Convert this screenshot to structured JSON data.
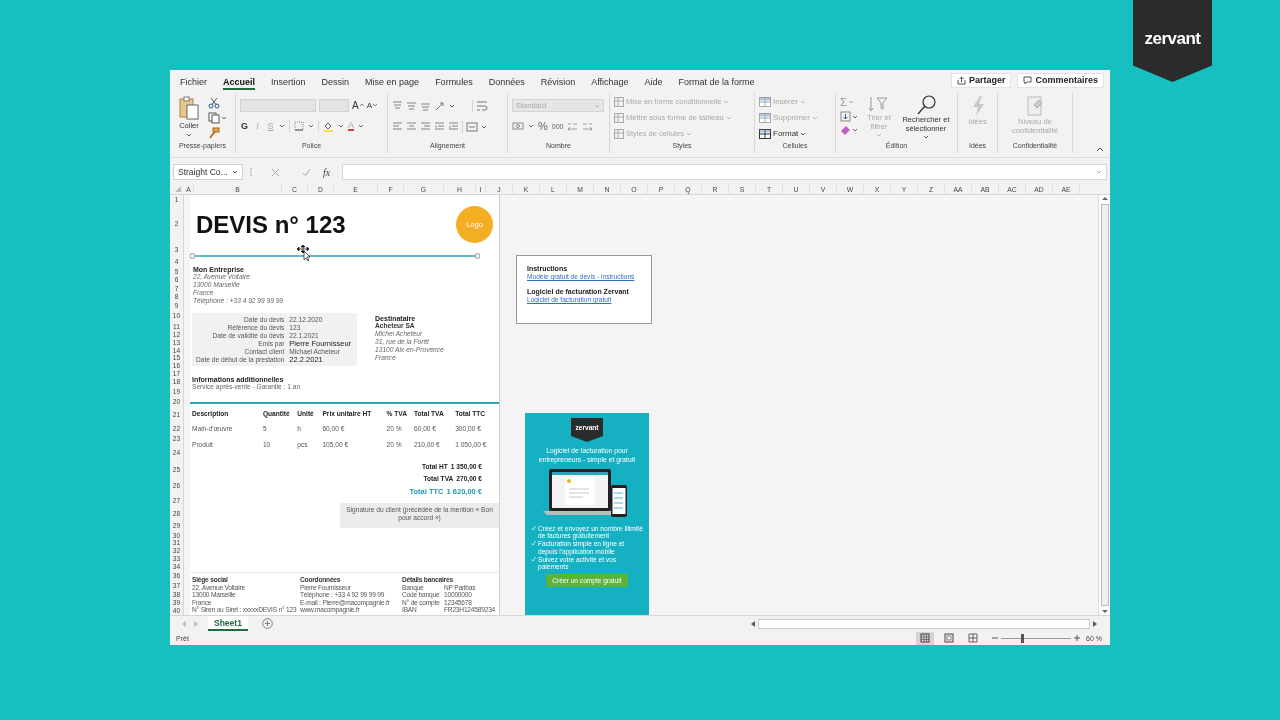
{
  "badge": {
    "text": "zervant"
  },
  "menu": {
    "tabs": [
      {
        "label": "Fichier",
        "selected": false
      },
      {
        "label": "Accueil",
        "selected": true
      },
      {
        "label": "Insertion",
        "selected": false
      },
      {
        "label": "Dessin",
        "selected": false
      },
      {
        "label": "Mise en page",
        "selected": false
      },
      {
        "label": "Formules",
        "selected": false
      },
      {
        "label": "Données",
        "selected": false
      },
      {
        "label": "Révision",
        "selected": false
      },
      {
        "label": "Affichage",
        "selected": false
      },
      {
        "label": "Aide",
        "selected": false
      },
      {
        "label": "Format de la forme",
        "selected": false
      }
    ],
    "actions": [
      {
        "kind": "share",
        "label": "Partager"
      },
      {
        "kind": "comments",
        "label": "Commentaires"
      }
    ]
  },
  "ribbon": {
    "groups": [
      {
        "kind": "clipboard",
        "label": "Presse-papiers",
        "paste": {
          "label": "Coller",
          "disabled": false
        }
      },
      {
        "kind": "font",
        "label": "Police",
        "fields": [
          {
            "kind": "font_name",
            "disabled": true
          },
          {
            "kind": "font_size",
            "disabled": true
          }
        ],
        "size_buttons": [
          {
            "kind": "grow",
            "label": "A"
          },
          {
            "kind": "shrink",
            "label": "A"
          }
        ],
        "styles": [
          {
            "label": "G",
            "disabled": false
          },
          {
            "label": "I",
            "disabled": true
          },
          {
            "label": "S",
            "disabled": true
          }
        ],
        "font_color": "A"
      },
      {
        "kind": "alignment",
        "label": "Alignement"
      },
      {
        "kind": "number",
        "label": "Nombre",
        "format": {
          "value": "Standard",
          "disabled": true
        },
        "symbols": [
          "%",
          "000"
        ]
      },
      {
        "kind": "styles",
        "label": "Styles",
        "items": [
          {
            "label": "Mise en forme conditionnelle",
            "disabled": true
          },
          {
            "label": "Mettre sous forme de tableau",
            "disabled": true
          },
          {
            "label": "Styles de cellules",
            "disabled": true
          }
        ]
      },
      {
        "kind": "cells",
        "label": "Cellules",
        "items": [
          {
            "label": "Insérer",
            "disabled": true
          },
          {
            "label": "Supprimer",
            "disabled": true
          },
          {
            "label": "Format",
            "disabled": false
          }
        ]
      },
      {
        "kind": "editing",
        "label": "Édition",
        "autosum": "Σ",
        "items": [
          {
            "label": "Trier et filtrer",
            "disabled": true
          },
          {
            "label": "Rechercher et sélectionner",
            "disabled": false
          }
        ]
      },
      {
        "kind": "ideas",
        "label": "Idées",
        "button": {
          "label": "Idées",
          "disabled": true
        }
      },
      {
        "kind": "sensitivity",
        "label": "Confidentialité",
        "button": {
          "label": "Niveau de confidentialité",
          "disabled": true
        }
      }
    ]
  },
  "formula_bar": {
    "name_box": "Straight Co...",
    "fx": "fx"
  },
  "sheet": {
    "columns": [
      "A",
      "B",
      "C",
      "D",
      "E",
      "F",
      "G",
      "H",
      "I",
      "J",
      "K",
      "L",
      "M",
      "N",
      "O",
      "P",
      "Q",
      "R",
      "S",
      "T",
      "U",
      "V",
      "W",
      "X",
      "Y",
      "Z",
      "AA",
      "AB",
      "AC",
      "AD",
      "AE"
    ],
    "rows": [
      "1",
      "2",
      "3",
      "4",
      "5",
      "6",
      "7",
      "8",
      "9",
      "10",
      "11",
      "12",
      "13",
      "14",
      "15",
      "16",
      "17",
      "18",
      "19",
      "20",
      "21",
      "22",
      "23",
      "24",
      "25",
      "26",
      "27",
      "28",
      "29",
      "30",
      "31",
      "32",
      "33",
      "34",
      "36",
      "37",
      "38",
      "39",
      "40"
    ]
  },
  "quote": {
    "title": "DEVIS n° 123",
    "logo": "Logo",
    "company": {
      "name": "Mon Entreprise",
      "lines": [
        "22, Avenue Voltaire",
        "13000 Marseille",
        "France",
        "Téléphone : +33 4 92 99 99 99"
      ]
    },
    "details": [
      {
        "label": "Date du devis",
        "value": "22.12.2020",
        "emphasis": false
      },
      {
        "label": "Référence du devis",
        "value": "123",
        "emphasis": false
      },
      {
        "label": "Date de validité du devis",
        "value": "22.1.2021",
        "emphasis": false
      },
      {
        "label": "Emis par",
        "value": "Pierre Fournisseur",
        "emphasis": true
      },
      {
        "label": "Contact client",
        "value": "Michael Acheteur",
        "emphasis": false
      },
      {
        "label": "Date de début de la prestation",
        "value": "22.2.2021",
        "emphasis": true
      }
    ],
    "recipient": {
      "heading": "Destinataire",
      "name": "Acheteur SA",
      "lines": [
        "Michel Acheteur",
        "31, rue de la Forêt",
        "13100 Aix-en-Provence",
        "France"
      ]
    },
    "additional": {
      "heading": "Informations additionnelles",
      "text": "Service après-vente - Garantie : 1 an"
    },
    "items": {
      "columns": [
        "Description",
        "Quantité",
        "Unité",
        "Prix unitaire HT",
        "% TVA",
        "Total TVA",
        "Total TTC"
      ],
      "rows": [
        [
          "Main-d'œuvre",
          "5",
          "h",
          "60,00 €",
          "20 %",
          "60,00 €",
          "300,00 €"
        ],
        [
          "Produit",
          "10",
          "pcs",
          "105,00 €",
          "20 %",
          "210,00 €",
          "1 050,00 €"
        ]
      ]
    },
    "totals": [
      {
        "label": "Total HT",
        "value": "1 350,00 €",
        "highlight": false
      },
      {
        "label": "Total TVA",
        "value": "270,00 €",
        "highlight": false
      },
      {
        "label": "Total TTC",
        "value": "1 620,00 €",
        "highlight": true
      }
    ],
    "signature": "Signature du client (précédée de la mention « Bon pour accord »)",
    "footer": [
      {
        "kind": "lines",
        "heading": "Siège social",
        "lines": [
          "22, Avenue Voltaire",
          "13000 Marseille",
          "France",
          "N° Siren ou Siret : xxxxxDEVIS n° 123"
        ]
      },
      {
        "kind": "lines",
        "heading": "Coordonnées",
        "lines": [
          "Pierre Fournisseur",
          "Téléphone : +33 4 92 99 99 99",
          "E-mail : Pierre@macompagnie.fr",
          "www.macompagnie.fr"
        ]
      },
      {
        "kind": "pairs",
        "heading": "Détails bancaires",
        "pairs": [
          {
            "label": "Banque",
            "value": "NP Paribas"
          },
          {
            "label": "Code banque",
            "value": "10000000"
          },
          {
            "label": "N° de compte",
            "value": "12345678"
          },
          {
            "label": "IBAN",
            "value": "FR23H124589234"
          }
        ]
      }
    ]
  },
  "instructions": {
    "items": [
      {
        "heading": "Instructions",
        "link": "Modèle gratuit de devis - instructions"
      },
      {
        "heading": "Logiciel de facturation Zervant",
        "link": "Logiciel de facturation gratuit"
      }
    ]
  },
  "promo": {
    "logo": "zervant",
    "headline": "Logiciel de facturation pour entrepreneurs - simple et gratuit",
    "bullets": [
      "Créez et envoyez un nombre illimité de factures gratuitement",
      "Facturation simple en ligne et depuis l'application mobile",
      "Suivez votre activité et vos paiements"
    ],
    "button": "Créer un compte gratuit"
  },
  "sheet_tabs": [
    {
      "label": "Sheet1",
      "selected": true
    }
  ],
  "status": {
    "text": "Prêt",
    "views": [
      {
        "kind": "normal",
        "selected": true
      },
      {
        "kind": "page_layout",
        "selected": false
      },
      {
        "kind": "page_break",
        "selected": false
      }
    ],
    "zoom": {
      "level": 0.3,
      "reading": "60 %"
    }
  }
}
